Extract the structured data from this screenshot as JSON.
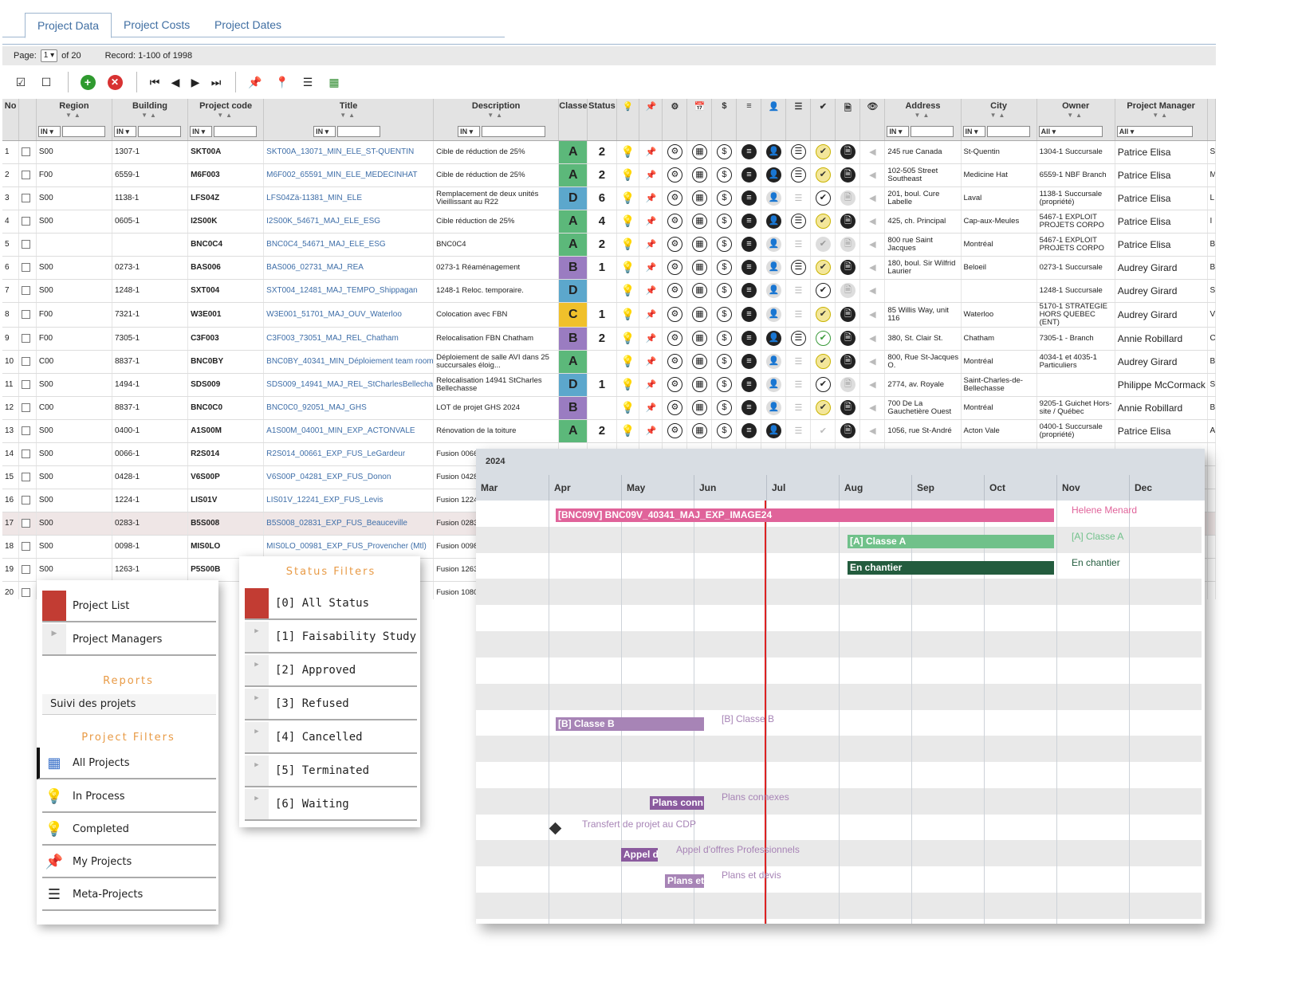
{
  "tabs": [
    "Project Data",
    "Project Costs",
    "Project Dates"
  ],
  "pager": {
    "page_label": "Page:",
    "page_value": "1",
    "page_of": "of 20",
    "record": "Record: 1-100 of 1998"
  },
  "toolbar": {
    "icons": [
      "check-all-icon",
      "uncheck-all-icon",
      "add-icon",
      "delete-icon",
      "first-page-icon",
      "prev-page-icon",
      "next-page-icon",
      "last-page-icon",
      "add-pin-icon",
      "remove-pin-icon",
      "meta-project-icon",
      "export-excel-icon"
    ]
  },
  "columns": {
    "no": "No",
    "region": "Region",
    "building": "Building",
    "code": "Project code",
    "title": "Title",
    "description": "Description",
    "classe": "Classe",
    "status": "Status",
    "address": "Address",
    "city": "City",
    "owner": "Owner",
    "pm": "Project Manager",
    "filter_in": "IN",
    "filter_all": "All"
  },
  "rows": [
    {
      "no": "1",
      "region": "S00",
      "building": "1307-1",
      "code": "SKT00A",
      "title": "SKT00A_13071_MIN_ELE_ST-QUENTIN",
      "desc": "Cible de réduction de 25%",
      "cls": "A",
      "status": "2",
      "address": "245 rue Canada",
      "city": "St-Quentin",
      "owner": "1304-1 Succursale",
      "pm": "Patrice Elisa",
      "x": "S",
      "ico": "full"
    },
    {
      "no": "2",
      "region": "F00",
      "building": "6559-1",
      "code": "M6F003",
      "title": "M6F002_65591_MIN_ELE_MEDECINHAT",
      "desc": "Cible de réduction de 25%",
      "cls": "A",
      "status": "2",
      "address": "102-505 Street Southeast",
      "city": "Medicine Hat",
      "owner": "6559-1 NBF Branch",
      "pm": "Patrice Elisa",
      "x": "M",
      "ico": "full"
    },
    {
      "no": "3",
      "region": "S00",
      "building": "1138-1",
      "code": "LFS04Z",
      "title": "LFS04Zä-11381_MIN_ELE",
      "desc": "Remplacement de deux unités Vieillissant au R22",
      "cls": "D",
      "status": "6",
      "address": "201, boul. Cure Labelle",
      "city": "Laval",
      "owner": "1138-1 Succursale (propriété)",
      "pm": "Patrice Elisa",
      "x": "L",
      "ico": "dim"
    },
    {
      "no": "4",
      "region": "S00",
      "building": "0605-1",
      "code": "I2S00K",
      "title": "I2S00K_54671_MAJ_ELE_ESG",
      "desc": "Cible réduction de 25%",
      "cls": "A",
      "status": "4",
      "address": "425, ch. Principal",
      "city": "Cap-aux-Meules",
      "owner": "5467-1 EXPLOIT PROJETS CORPO",
      "pm": "Patrice Elisa",
      "x": "I",
      "ico": "full"
    },
    {
      "no": "5",
      "region": "",
      "building": "",
      "code": "BNC0C4",
      "title": "BNC0C4_54671_MAJ_ELE_ESG",
      "desc": "BNC0C4",
      "cls": "A",
      "status": "2",
      "address": "800 rue Saint Jacques",
      "city": "Montréal",
      "owner": "5467-1 EXPLOIT PROJETS CORPO",
      "pm": "Patrice Elisa",
      "x": "B",
      "ico": "dim2"
    },
    {
      "no": "6",
      "region": "S00",
      "building": "0273-1",
      "code": "BAS006",
      "title": "BAS006_02731_MAJ_REA",
      "desc": "0273-1 Réaménagement",
      "cls": "B",
      "status": "1",
      "address": "180, boul. Sir Wilfrid Laurier",
      "city": "Beloeil",
      "owner": "0273-1 Succursale",
      "pm": "Audrey Girard",
      "x": "B",
      "ico": "part"
    },
    {
      "no": "7",
      "region": "S00",
      "building": "1248-1",
      "code": "SXT004",
      "title": "SXT004_12481_MAJ_TEMPO_Shippagan",
      "desc": "1248-1 Reloc. temporaire.",
      "cls": "D",
      "status": "",
      "address": "",
      "city": "",
      "owner": "1248-1 Succursale",
      "pm": "Audrey Girard",
      "x": "S",
      "ico": "dim"
    },
    {
      "no": "8",
      "region": "F00",
      "building": "7321-1",
      "code": "W3E001",
      "title": "W3E001_51701_MAJ_OUV_Waterloo",
      "desc": "Colocation avec FBN",
      "cls": "C",
      "status": "1",
      "address": "85 Willis Way, unit 116",
      "city": "Waterloo",
      "owner": "5170-1 STRATEGIE HORS QUEBEC (ENT)",
      "pm": "Audrey Girard",
      "x": "V",
      "ico": "dimy"
    },
    {
      "no": "9",
      "region": "F00",
      "building": "7305-1",
      "code": "C3F003",
      "title": "C3F003_73051_MAJ_REL_Chatham",
      "desc": "Relocalisation FBN Chatham",
      "cls": "B",
      "status": "2",
      "address": "380, St. Clair St.",
      "city": "Chatham",
      "owner": "7305-1 - Branch",
      "pm": "Annie Robillard",
      "x": "C",
      "ico": "fullg"
    },
    {
      "no": "10",
      "region": "C00",
      "building": "8837-1",
      "code": "BNC0BY",
      "title": "BNC0BY_40341_MIN_Déploiement team room",
      "desc": "Déploiement de salle AVI dans 25 succursales éloig...",
      "cls": "A",
      "status": "",
      "address": "800, Rue St-Jacques O.",
      "city": "Montréal",
      "owner": "4034-1 et 4035-1 Particuliers",
      "pm": "Audrey Girard",
      "x": "B",
      "ico": "dimy"
    },
    {
      "no": "11",
      "region": "S00",
      "building": "1494-1",
      "code": "SDS009",
      "title": "SDS009_14941_MAJ_REL_StCharlesBellechass",
      "desc": "Relocalisation 14941 StCharles Bellechasse",
      "cls": "D",
      "status": "1",
      "address": "2774, av. Royale",
      "city": "Saint-Charles-de-Bellechasse",
      "owner": "",
      "pm": "Philippe McCormack",
      "x": "S",
      "ico": "dim"
    },
    {
      "no": "12",
      "region": "C00",
      "building": "8837-1",
      "code": "BNC0C0",
      "title": "BNC0C0_92051_MAJ_GHS",
      "desc": "LOT de projet GHS 2024",
      "cls": "B",
      "status": "",
      "address": "700 De La Gauchetière Ouest",
      "city": "Montréal",
      "owner": "9205-1 Guichet Hors-site / Québec",
      "pm": "Annie Robillard",
      "x": "B",
      "ico": "dimy"
    },
    {
      "no": "13",
      "region": "S00",
      "building": "0400-1",
      "code": "A1S00M",
      "title": "A1S00M_04001_MIN_EXP_ACTONVALE",
      "desc": "Rénovation de la toiture",
      "cls": "A",
      "status": "2",
      "address": "1056, rue St-André",
      "city": "Acton Vale",
      "owner": "0400-1 Succursale (propriété)",
      "pm": "Patrice Elisa",
      "x": "A",
      "ico": "part2"
    },
    {
      "no": "14",
      "region": "S00",
      "building": "0066-1",
      "code": "R2S014",
      "title": "R2S014_00661_EXP_FUS_LeGardeur",
      "desc": "Fusion 0066-1 L...",
      "cls": "",
      "status": "",
      "address": "",
      "city": "",
      "owner": "",
      "pm": "",
      "x": "",
      "ico": "none"
    },
    {
      "no": "15",
      "region": "S00",
      "building": "0428-1",
      "code": "V6S00P",
      "title": "V6S00P_04281_EXP_FUS_Donon",
      "desc": "Fusion 0428-1 \\",
      "cls": "",
      "status": "",
      "address": "",
      "city": "",
      "owner": "",
      "pm": "",
      "x": "",
      "ico": "none"
    },
    {
      "no": "16",
      "region": "S00",
      "building": "1224-1",
      "code": "LIS01V",
      "title": "LIS01V_12241_EXP_FUS_Levis",
      "desc": "Fusion 1224-1 L",
      "cls": "",
      "status": "",
      "address": "",
      "city": "",
      "owner": "",
      "pm": "",
      "x": "",
      "ico": "none"
    },
    {
      "no": "17",
      "region": "S00",
      "building": "0283-1",
      "code": "B5S008",
      "title": "B5S008_02831_EXP_FUS_Beauceville",
      "desc": "Fusion 0283-1 E",
      "cls": "",
      "status": "",
      "address": "",
      "city": "",
      "owner": "",
      "pm": "",
      "x": "",
      "ico": "none",
      "hl": true
    },
    {
      "no": "18",
      "region": "S00",
      "building": "0098-1",
      "code": "MIS0LO",
      "title": "MIS0LO_00981_EXP_FUS_Provencher (Mtl)",
      "desc": "Fusion 0098-1 F",
      "cls": "",
      "status": "",
      "address": "",
      "city": "",
      "owner": "",
      "pm": "",
      "x": "",
      "ico": "none"
    },
    {
      "no": "19",
      "region": "S00",
      "building": "1263-1",
      "code": "P5S00B",
      "title": "",
      "desc": "Fusion 1263-1 F",
      "cls": "",
      "status": "",
      "address": "",
      "city": "",
      "owner": "",
      "pm": "",
      "x": "",
      "ico": "none"
    },
    {
      "no": "20",
      "region": "",
      "building": "",
      "code": "",
      "title": "",
      "desc": "Fusion 1080-1 C",
      "cls": "",
      "status": "",
      "address": "",
      "city": "",
      "owner": "",
      "pm": "",
      "x": "",
      "ico": "none"
    }
  ],
  "menu": {
    "project_list": "Project List",
    "project_managers": "Project Managers",
    "reports_heading": "Reports",
    "report_item": "Suivi des projets",
    "filters_heading": "Project Filters",
    "filters": [
      {
        "label": "All Projects",
        "icon": "grid-icon"
      },
      {
        "label": "In Process",
        "icon": "bulb-yellow-icon"
      },
      {
        "label": "Completed",
        "icon": "bulb-grey-icon"
      },
      {
        "label": "My Projects",
        "icon": "pin-icon"
      },
      {
        "label": "Meta-Projects",
        "icon": "meta-project-icon"
      }
    ]
  },
  "status_filters": {
    "heading": "Status Filters",
    "items": [
      "[0] All Status",
      "[1] Faisability Study",
      "[2] Approved",
      "[3] Refused",
      "[4] Cancelled",
      "[5] Terminated",
      "[6] Waiting"
    ]
  },
  "gantt": {
    "year": "2024",
    "months": [
      "Mar",
      "Apr",
      "May",
      "Jun",
      "Jul",
      "Aug",
      "Sep",
      "Oct",
      "Nov",
      "Dec"
    ],
    "bars": {
      "main": "[BNC09V] BNC09V_40341_MAJ_EXP_IMAGE24",
      "main_label": "Helene Menard",
      "classe_a": "[A] Classe A",
      "classe_a_label": "[A] Classe A",
      "chantier": "En chantier",
      "chantier_label": "En chantier",
      "classe_b": "[B] Classe B",
      "classe_b_label": "[B] Classe B",
      "plans_conn": "Plans conn",
      "plans_conn_label": "Plans connexes",
      "transfert_label": "Transfert de projet au CDP",
      "appel": "Appel d",
      "appel_label": "Appel d'offres Professionnels",
      "plans_et": "Plans et",
      "plans_et_label": "Plans et devis"
    },
    "colors": {
      "pink": "#e0639a",
      "green": "#70c18a",
      "darkgreen": "#235c3e",
      "purple": "#a784b6",
      "violet": "#8a5a9e",
      "today": "#d22222"
    }
  }
}
